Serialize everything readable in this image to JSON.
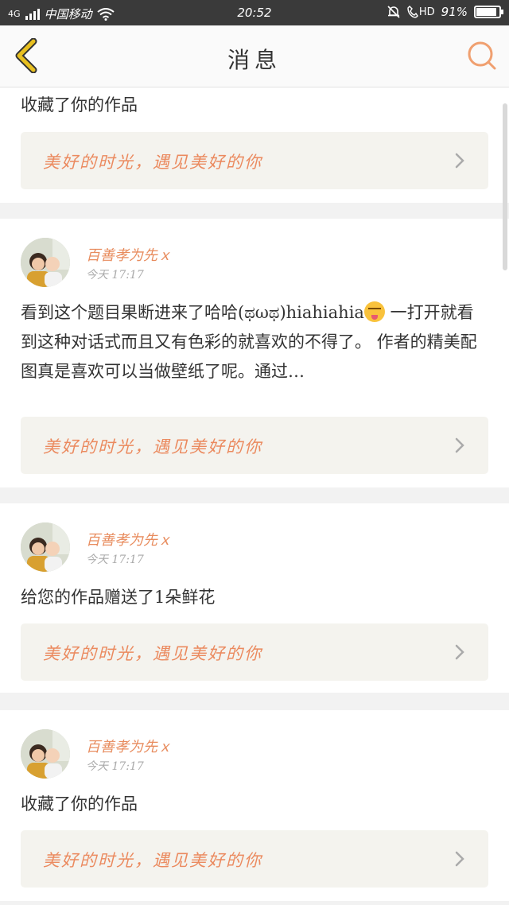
{
  "status_bar": {
    "network": "4G",
    "carrier": "中国移动",
    "time": "20:52",
    "hd_label": "HD",
    "battery_percent": "91%",
    "battery_level": 0.91
  },
  "header": {
    "title": "消息",
    "back_icon": "chevron-left-icon",
    "search_icon": "search-icon"
  },
  "colors": {
    "accent": "#eb8a5f",
    "back_icon": "#e8c020",
    "link_bg": "#f4f3ee"
  },
  "feed": [
    {
      "user": null,
      "message": "收藏了你的作品",
      "work_title": "美好的时光，遇见美好的你"
    },
    {
      "user": {
        "name": "百善孝为先ｘ",
        "time": "今天 17:17"
      },
      "message_before_emoji": "看到这个题目果断进来了哈哈(ಥωಥ)hiahiahia",
      "message_after_emoji": " 一打开就看到这种对话式而且又有色彩的就喜欢的不得了。 作者的精美配图真是喜欢可以当做壁纸了呢。通过…",
      "emoji": "squinting-tongue-emoji",
      "work_title": "美好的时光，遇见美好的你"
    },
    {
      "user": {
        "name": "百善孝为先ｘ",
        "time": "今天 17:17"
      },
      "message": "给您的作品赠送了1朵鲜花",
      "work_title": "美好的时光，遇见美好的你"
    },
    {
      "user": {
        "name": "百善孝为先ｘ",
        "time": "今天 17:17"
      },
      "message": "收藏了你的作品",
      "work_title": "美好的时光，遇见美好的你"
    }
  ]
}
